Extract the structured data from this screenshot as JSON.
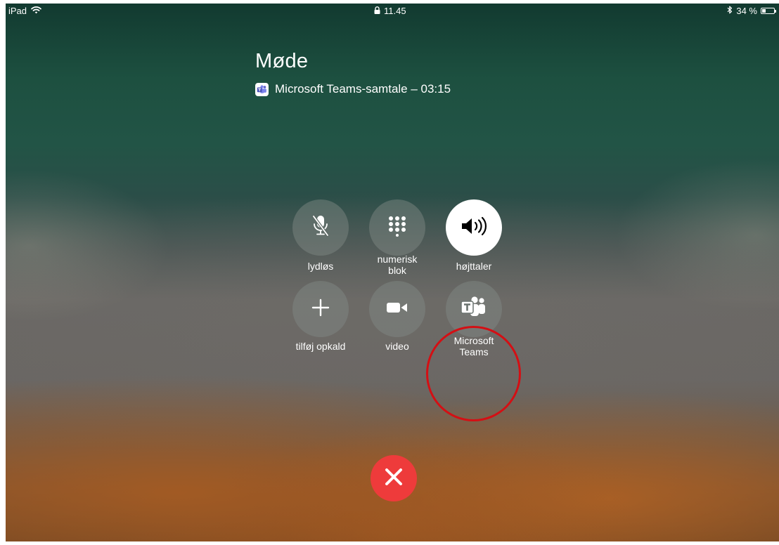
{
  "status_bar": {
    "device": "iPad",
    "time": "11.45",
    "battery_percent": "34 %",
    "battery_level": 0.34
  },
  "call": {
    "title": "Møde",
    "subtitle": "Microsoft Teams-samtale – 03:15"
  },
  "controls": {
    "mute": {
      "label": "lydløs",
      "icon": "mic-off-icon"
    },
    "keypad": {
      "label_line1": "numerisk",
      "label_line2": "blok",
      "icon": "keypad-icon"
    },
    "speaker": {
      "label": "højttaler",
      "icon": "speaker-icon",
      "active": true
    },
    "add_call": {
      "label": "tilføj opkald",
      "icon": "plus-icon"
    },
    "video": {
      "label": "video",
      "icon": "video-camera-icon"
    },
    "teams": {
      "label_line1": "Microsoft",
      "label_line2": "Teams",
      "icon": "microsoft-teams-icon"
    }
  },
  "end_call": {
    "icon": "close-icon",
    "color": "#ee3b3b"
  },
  "annotation": {
    "color": "#d40f14"
  }
}
